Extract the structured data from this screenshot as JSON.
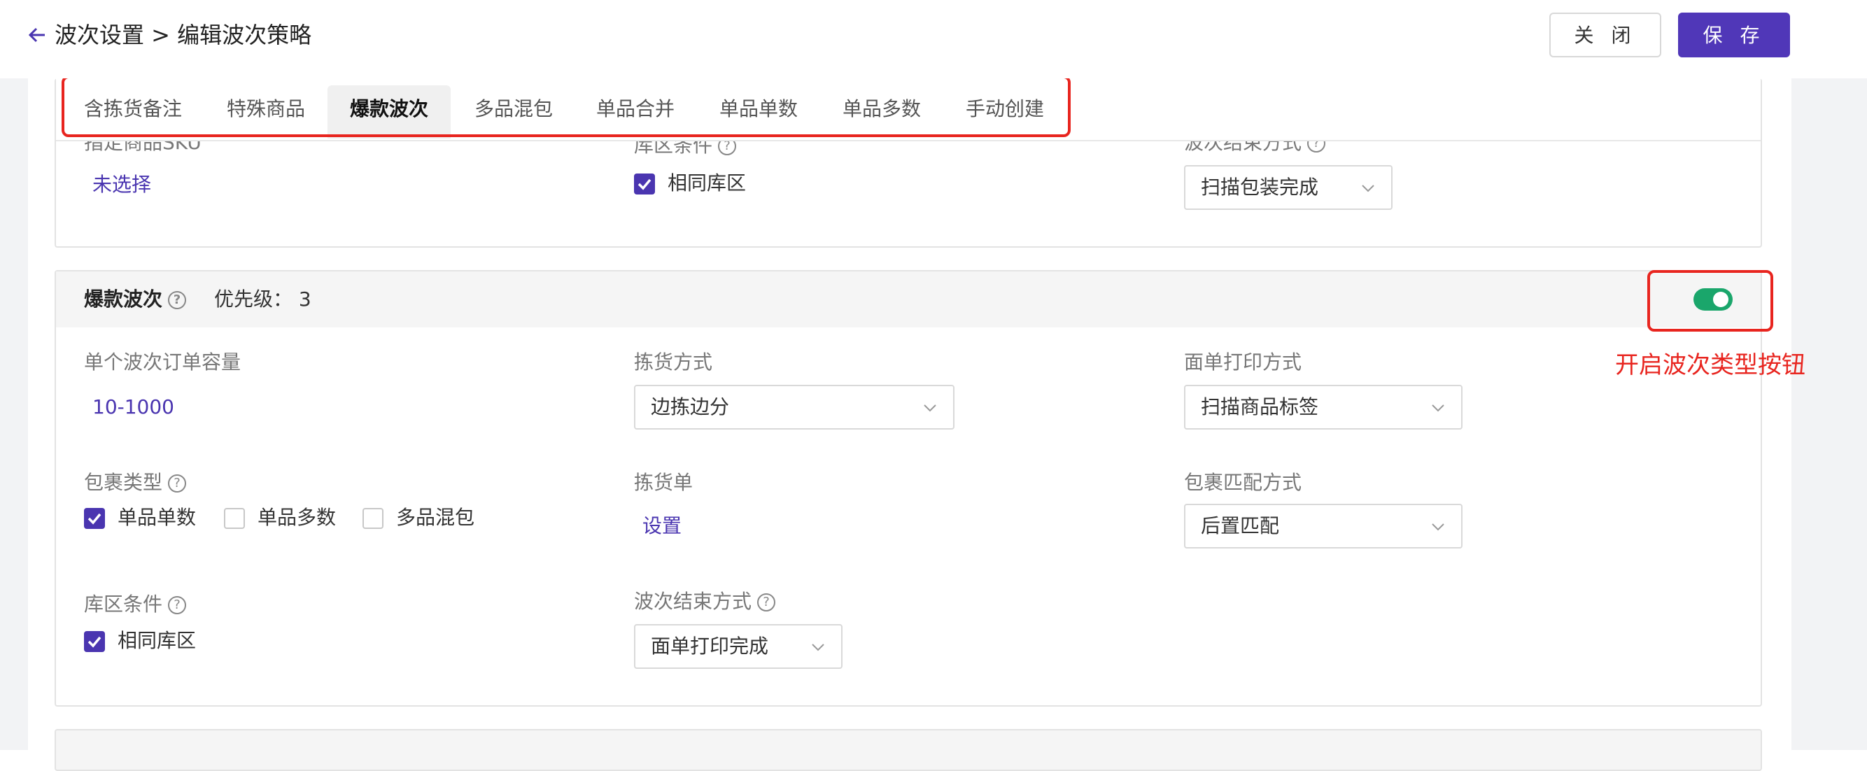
{
  "header": {
    "breadcrumb": "波次设置 > 编辑波次策略",
    "close_label": "关 闭",
    "save_label": "保 存"
  },
  "tabs": [
    {
      "label": "含拣货备注",
      "active": false
    },
    {
      "label": "特殊商品",
      "active": false
    },
    {
      "label": "爆款波次",
      "active": true
    },
    {
      "label": "多品混包",
      "active": false
    },
    {
      "label": "单品合并",
      "active": false
    },
    {
      "label": "单品单数",
      "active": false
    },
    {
      "label": "单品多数",
      "active": false
    },
    {
      "label": "手动创建",
      "active": false
    }
  ],
  "prev_card": {
    "sku_label": "指定商品SKU",
    "sku_value": "未选择",
    "zone_label": "库区条件",
    "zone_option": "相同库区",
    "end_label": "波次结束方式",
    "end_value": "扫描包装完成"
  },
  "main_card": {
    "title": "爆款波次",
    "priority_label": "优先级：",
    "priority_value": "3",
    "toggle_on": true,
    "capacity_label": "单个波次订单容量",
    "capacity_value": "10-1000",
    "pick_method_label": "拣货方式",
    "pick_method_value": "边拣边分",
    "print_method_label": "面单打印方式",
    "print_method_value": "扫描商品标签",
    "package_type_label": "包裹类型",
    "package_options": [
      {
        "label": "单品单数",
        "checked": true
      },
      {
        "label": "单品多数",
        "checked": false
      },
      {
        "label": "多品混包",
        "checked": false
      }
    ],
    "pick_list_label": "拣货单",
    "pick_list_value": "设置",
    "match_label": "包裹匹配方式",
    "match_value": "后置匹配",
    "zone_label": "库区条件",
    "zone_option": "相同库区",
    "end_label": "波次结束方式",
    "end_value": "面单打印完成"
  },
  "annotation": "开启波次类型按钮",
  "colors": {
    "accent": "#5037b8",
    "toggle_on": "#1aa66b",
    "annotation_red": "#e8251f"
  }
}
